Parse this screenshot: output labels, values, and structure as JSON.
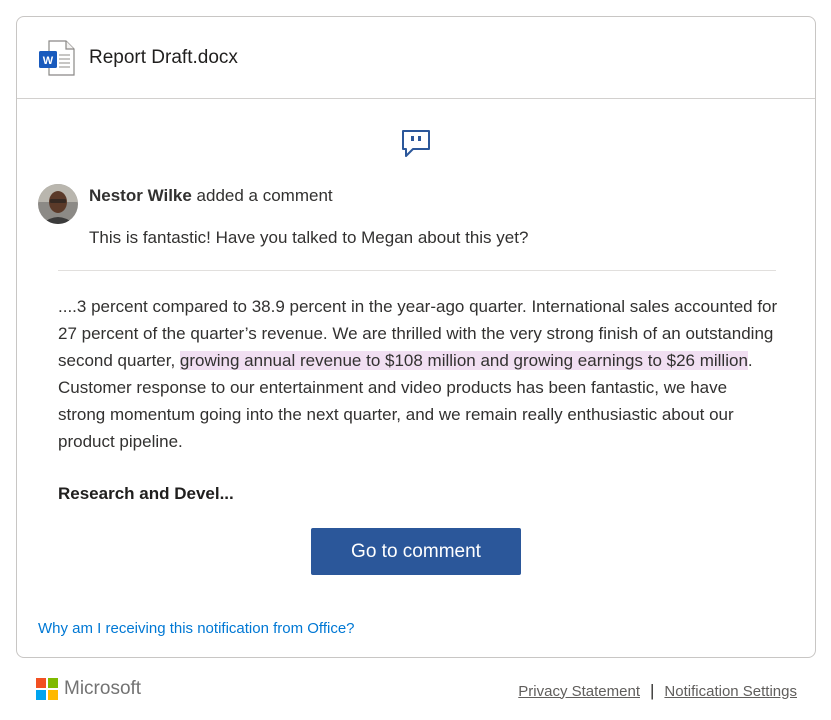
{
  "header": {
    "file_name": "Report Draft.docx",
    "file_icon": "word-document-icon",
    "icon_letter": "W"
  },
  "comment": {
    "icon": "comment-icon",
    "author": "Nestor Wilke",
    "action": " added a comment",
    "text": "This is fantastic! Have you talked to Megan about this yet?"
  },
  "excerpt": {
    "before": "....3 percent compared to 38.9 percent in the year-ago quarter. International sales accounted for 27 percent of the quarter’s revenue. We are thrilled with the very strong finish of an outstanding second quarter, ",
    "highlighted": "growing annual revenue to $108 million and growing earnings to $26 million",
    "after": ". Customer response to our entertainment and video products has been fantastic, we have strong momentum going into the next quarter, and we remain really enthusiastic about our product pipeline.",
    "section_title": "Research and Devel..."
  },
  "actions": {
    "go_to_comment": "Go to comment"
  },
  "why_link": "Why am I receiving this notification from Office?",
  "footer": {
    "brand": "Microsoft",
    "privacy": "Privacy Statement",
    "separator": "|",
    "settings": "Notification Settings"
  },
  "colors": {
    "accent": "#2b579a",
    "highlight": "#f1dff2",
    "link": "#0078d4"
  }
}
